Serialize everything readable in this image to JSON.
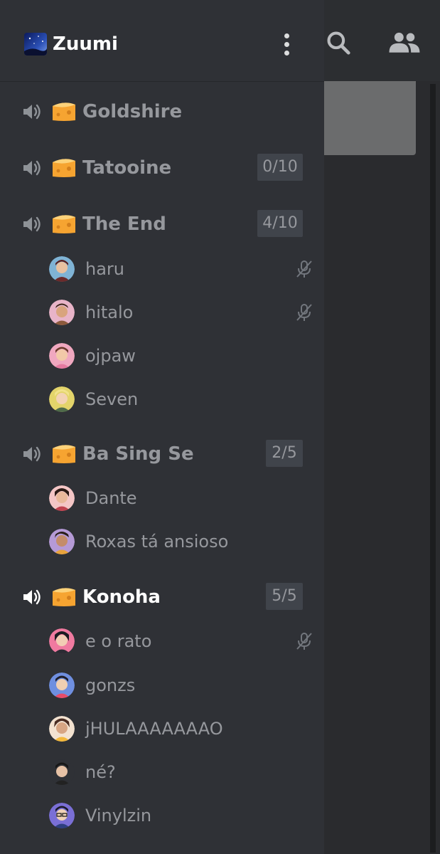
{
  "server": {
    "name": "Zuumi"
  },
  "header_icons": [
    "search-icon",
    "members-icon"
  ],
  "channels": [
    {
      "name": "Goldshire",
      "limit": ""
    },
    {
      "name": "Tatooine",
      "limit": "0/10"
    },
    {
      "name": "The End",
      "limit": "4/10"
    },
    {
      "name": "Ba Sing Se",
      "limit": "2/5"
    },
    {
      "name": "Konoha",
      "limit": "5/5"
    }
  ],
  "members": {
    "the_end": [
      "haru",
      "hitalo",
      "ojpaw",
      "Seven"
    ],
    "ba_sing_se": [
      "Dante",
      "Roxas tá ansioso"
    ],
    "konoha": [
      "e o rato",
      "gonzs",
      "jHULAAAAAAAO",
      "né?",
      "Vinylzin"
    ]
  },
  "colors": {
    "drawer_bg": "#2f3136",
    "muted_text": "#96989d",
    "active_text": "#ffffff",
    "limit_bg": "#40444b"
  }
}
